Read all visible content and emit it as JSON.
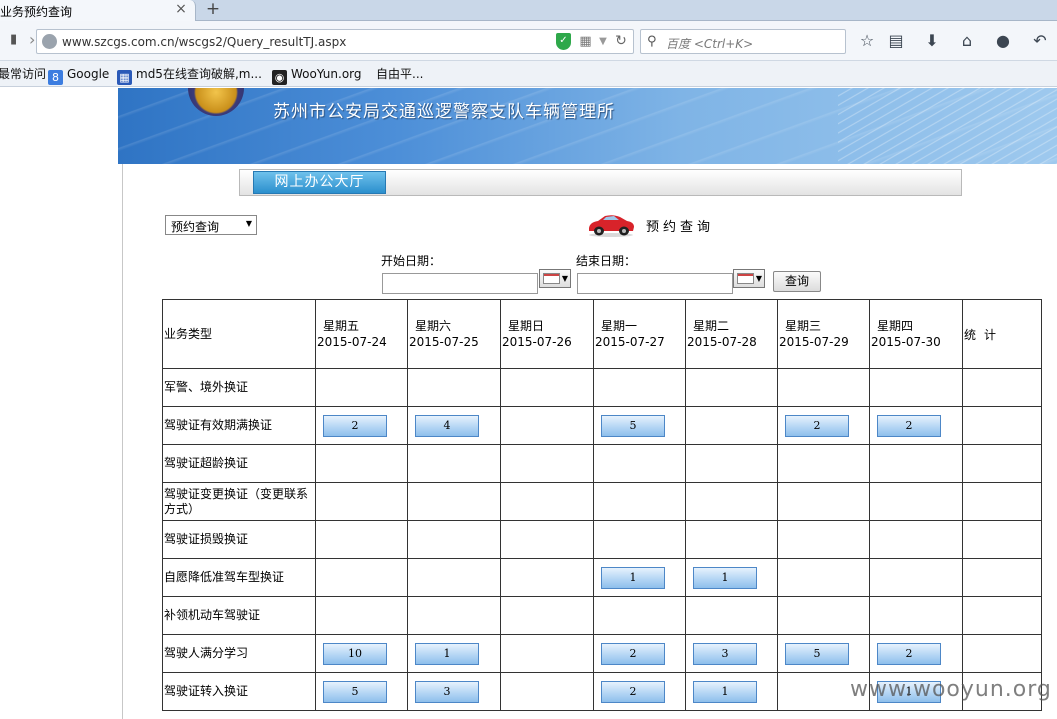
{
  "browser": {
    "tab_title": "业务预约查询",
    "close_glyph": "×",
    "newtab_glyph": "+",
    "url": "www.szcgs.com.cn/wscgs2/Query_resultTJ.aspx",
    "search_placeholder": "百度 <Ctrl+K>",
    "bookmarks": [
      "最常访问",
      "Google",
      "md5在线查询破解,m...",
      "WooYun.org",
      "自由平..."
    ]
  },
  "banner": {
    "title": "苏州市公安局交通巡逻警察支队车辆管理所"
  },
  "hall": {
    "tab_label": "网上办公大厅"
  },
  "query": {
    "select_value": "预约查询",
    "heading": "预约查询",
    "start_label": "开始日期：",
    "end_label": "结束日期：",
    "start_value": "",
    "end_value": "",
    "submit_label": "查询"
  },
  "table": {
    "type_header": "业务类型",
    "stat_header": "统计",
    "days": [
      {
        "name": "星期五",
        "date": "2015-07-24"
      },
      {
        "name": "星期六",
        "date": "2015-07-25"
      },
      {
        "name": "星期日",
        "date": "2015-07-26"
      },
      {
        "name": "星期一",
        "date": "2015-07-27"
      },
      {
        "name": "星期二",
        "date": "2015-07-28"
      },
      {
        "name": "星期三",
        "date": "2015-07-29"
      },
      {
        "name": "星期四",
        "date": "2015-07-30"
      }
    ],
    "rows": [
      {
        "type": "军警、境外换证",
        "counts": [
          "",
          "",
          "",
          "",
          "",
          "",
          ""
        ]
      },
      {
        "type": "驾驶证有效期满换证",
        "counts": [
          "2",
          "4",
          "",
          "5",
          "",
          "2",
          "2"
        ]
      },
      {
        "type": "驾驶证超龄换证",
        "counts": [
          "",
          "",
          "",
          "",
          "",
          "",
          ""
        ]
      },
      {
        "type": "驾驶证变更换证（变更联系方式）",
        "counts": [
          "",
          "",
          "",
          "",
          "",
          "",
          ""
        ]
      },
      {
        "type": "驾驶证损毁换证",
        "counts": [
          "",
          "",
          "",
          "",
          "",
          "",
          ""
        ]
      },
      {
        "type": "自愿降低准驾车型换证",
        "counts": [
          "",
          "",
          "",
          "1",
          "1",
          "",
          ""
        ]
      },
      {
        "type": "补领机动车驾驶证",
        "counts": [
          "",
          "",
          "",
          "",
          "",
          "",
          ""
        ]
      },
      {
        "type": "驾驶人满分学习",
        "counts": [
          "10",
          "1",
          "",
          "2",
          "3",
          "5",
          "2"
        ]
      },
      {
        "type": "驾驶证转入换证",
        "counts": [
          "5",
          "3",
          "",
          "2",
          "1",
          "",
          "1"
        ]
      }
    ]
  },
  "watermark": "www.wooyun.org"
}
